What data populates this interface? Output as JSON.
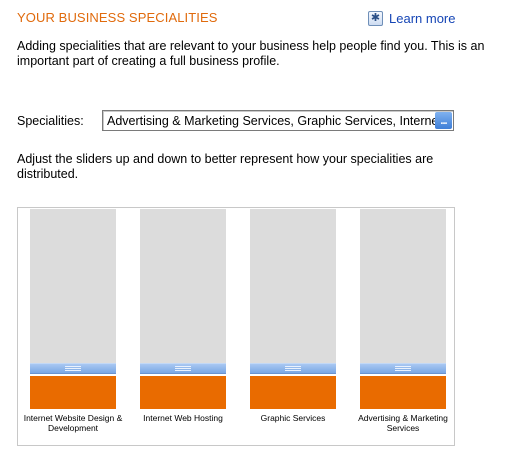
{
  "header": {
    "title": "YOUR BUSINESS SPECIALITIES",
    "learn_more": "Learn more"
  },
  "intro_text": "Adding specialities that are relevant to your business help people find you. This is an important part of creating a full business profile.",
  "specialities": {
    "label": "Specialities:",
    "value": "Advertising & Marketing Services, Graphic Services, Internet Web Hosting, Internet Website Design & Development",
    "more_button": "..."
  },
  "adjust_text": "Adjust the sliders up and down to better represent how your specialities are distributed.",
  "sliders": [
    {
      "label": "Internet Website Design & Development",
      "level": 0.25
    },
    {
      "label": "Internet Web Hosting",
      "level": 0.25
    },
    {
      "label": "Graphic Services",
      "level": 0.25
    },
    {
      "label": "Advertising & Marketing Services",
      "level": 0.25
    }
  ],
  "colors": {
    "title": "#e06a0c",
    "link": "#1545b5",
    "track": "#dcdcdc",
    "fill": "#e96b00",
    "handle": "#8fb5ea"
  },
  "icons": {
    "learn_more": "help-book-icon"
  }
}
